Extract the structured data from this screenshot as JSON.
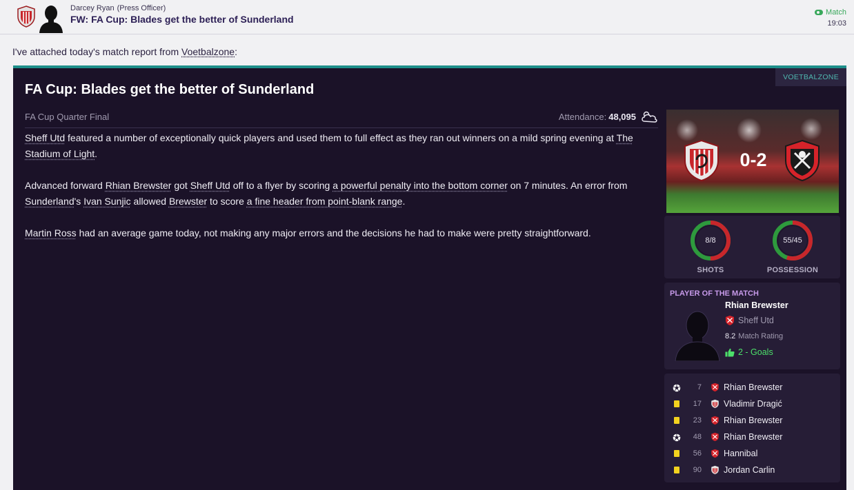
{
  "header": {
    "sender_name": "Darcey Ryan",
    "sender_role": "(Press Officer)",
    "subject": "FW: FA Cup: Blades get the better of Sunderland",
    "tag": "Match",
    "time": "19:03"
  },
  "intro": {
    "before": "I've attached today's match report from ",
    "source": "Voetbalzone",
    "after": ":"
  },
  "article": {
    "source_tag": "VOETBALZONE",
    "title": "FA Cup: Blades get the better of Sunderland",
    "competition": "FA Cup Quarter Final",
    "attendance_label": "Attendance:",
    "attendance_value": "48,095",
    "weather_icon": "cloudy-icon",
    "p1": {
      "team": "Sheff Utd",
      "a": " featured a number of exceptionally quick players and used them to full effect as they ran out winners on a mild spring evening at ",
      "stadium": "The Stadium of Light",
      "b": "."
    },
    "p2": {
      "a": "Advanced forward ",
      "player": "Rhian Brewster",
      "b": " got ",
      "team": "Sheff Utd",
      "c": " off to a flyer by scoring ",
      "goal1": "a powerful penalty into the bottom corner",
      "d": " on 7 minutes. An error from ",
      "team2": "Sunderland",
      "e": "'s ",
      "player2": "Ivan Sunjic",
      "f": " allowed ",
      "player3": "Brewster",
      "g": " to score ",
      "goal2": "a fine header from point-blank range",
      "h": "."
    },
    "p3": {
      "ref": "Martin Ross",
      "a": " had an average game today, not making any major errors and the decisions he had to make were pretty straightforward."
    }
  },
  "score": {
    "text": "0-2",
    "home_badge": "sunderland-badge",
    "away_badge": "sheff-utd-badge"
  },
  "stats": {
    "shots_value": "8/8",
    "shots_label": "SHOTS",
    "shots_home_fraction": 0.5,
    "possession_value": "55/45",
    "possession_label": "POSSESSION",
    "possession_home_fraction": 0.55,
    "colors": {
      "home": "#c8262b",
      "away": "#2e9a3d"
    }
  },
  "potm": {
    "heading": "PLAYER OF THE MATCH",
    "name": "Rhian Brewster",
    "club": "Sheff Utd",
    "rating": "8.2",
    "rating_label": "Match Rating",
    "goals": "2 - Goals"
  },
  "events": [
    {
      "type": "goal",
      "minute": "7",
      "club": "sheff-utd",
      "player": "Rhian Brewster"
    },
    {
      "type": "yellow",
      "minute": "17",
      "club": "sunderland",
      "player": "Vladimir Dragić"
    },
    {
      "type": "yellow",
      "minute": "23",
      "club": "sheff-utd",
      "player": "Rhian Brewster"
    },
    {
      "type": "goal",
      "minute": "48",
      "club": "sheff-utd",
      "player": "Rhian Brewster"
    },
    {
      "type": "yellow",
      "minute": "56",
      "club": "sheff-utd",
      "player": "Hannibal"
    },
    {
      "type": "yellow",
      "minute": "90",
      "club": "sunderland",
      "player": "Jordan Carlin"
    }
  ]
}
